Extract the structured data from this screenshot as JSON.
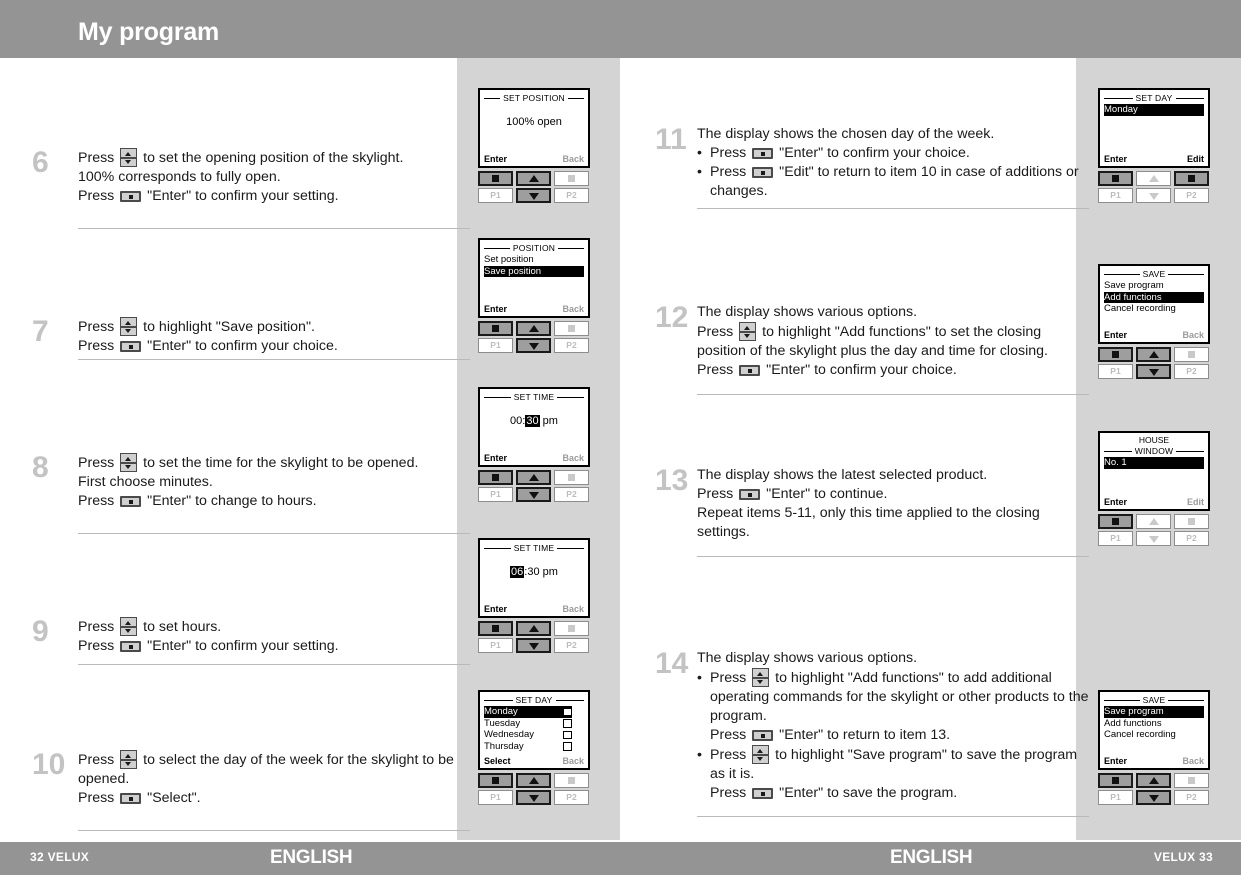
{
  "header": {
    "title": "My program"
  },
  "footer": {
    "left_page": "32  VELUX",
    "left_lang": "ENGLISH",
    "right_lang": "ENGLISH",
    "right_page": "VELUX  33"
  },
  "keys": {
    "updown_icon": "up-down-rocker-key",
    "enter_icon": "enter-key"
  },
  "steps_left": [
    {
      "number": "6",
      "lines": [
        {
          "pre": "Press ",
          "key": "updown",
          "post": " to set the opening position of the skylight."
        },
        {
          "pre": "100% corresponds to fully open.",
          "key": null,
          "post": ""
        },
        {
          "pre": "Press ",
          "key": "enter",
          "post": " \"Enter\" to confirm your setting."
        }
      ]
    },
    {
      "number": "7",
      "lines": [
        {
          "pre": "Press ",
          "key": "updown",
          "post": " to highlight \"Save position\"."
        },
        {
          "pre": "Press ",
          "key": "enter",
          "post": " \"Enter\" to confirm your choice."
        }
      ]
    },
    {
      "number": "8",
      "lines": [
        {
          "pre": "Press ",
          "key": "updown",
          "post": " to set the time for the skylight to be opened."
        },
        {
          "pre": "First choose minutes.",
          "key": null,
          "post": ""
        },
        {
          "pre": "Press ",
          "key": "enter",
          "post": " \"Enter\" to change to hours."
        }
      ]
    },
    {
      "number": "9",
      "lines": [
        {
          "pre": "Press ",
          "key": "updown",
          "post": " to set hours."
        },
        {
          "pre": "Press ",
          "key": "enter",
          "post": " \"Enter\" to confirm your setting."
        }
      ]
    },
    {
      "number": "10",
      "lines": [
        {
          "pre": "Press ",
          "key": "updown",
          "post": " to select the day of the week for the skylight to be opened."
        },
        {
          "pre": "Press ",
          "key": "enter",
          "post": " \"Select\"."
        }
      ]
    }
  ],
  "steps_right": [
    {
      "number": "11",
      "lines": [
        {
          "pre": "The display shows the chosen day of the week.",
          "key": null,
          "post": ""
        },
        {
          "bullet": true,
          "pre": "Press ",
          "key": "enter",
          "post": " \"Enter\" to confirm your choice."
        },
        {
          "bullet": true,
          "pre": "Press ",
          "key": "enter",
          "post": " \"Edit\" to return to item 10 in case of additions or changes."
        }
      ]
    },
    {
      "number": "12",
      "lines": [
        {
          "pre": "The display shows various options.",
          "key": null,
          "post": ""
        },
        {
          "pre": "Press ",
          "key": "updown",
          "post": " to highlight \"Add functions\" to set the closing position of the skylight plus the day and time for closing."
        },
        {
          "pre": "Press ",
          "key": "enter",
          "post": " \"Enter\" to confirm your choice."
        }
      ]
    },
    {
      "number": "13",
      "lines": [
        {
          "pre": "The display shows the latest selected product.",
          "key": null,
          "post": ""
        },
        {
          "pre": "Press ",
          "key": "enter",
          "post": " \"Enter\" to continue."
        },
        {
          "pre": "Repeat items 5-11, only this time applied to the closing settings.",
          "key": null,
          "post": ""
        }
      ]
    },
    {
      "number": "14",
      "lines": [
        {
          "pre": "The display shows various options.",
          "key": null,
          "post": ""
        },
        {
          "bullet": true,
          "pre": "Press ",
          "key": "updown",
          "post": " to highlight \"Add functions\" to add additional operating commands for the skylight or other products to the program."
        },
        {
          "pre": "Press ",
          "key": "enter",
          "post": " \"Enter\" to return to item 13.",
          "indent": true
        },
        {
          "bullet": true,
          "pre": "Press ",
          "key": "updown",
          "post": " to highlight \"Save program\" to save the program as it is."
        },
        {
          "pre": "Press ",
          "key": "enter",
          "post": " \"Enter\" to save the program.",
          "indent": true
        }
      ]
    }
  ],
  "units_left": [
    {
      "id": "set-position",
      "title": "SET POSITION",
      "title_style": "rules-both",
      "center": "100% open",
      "rows": [],
      "foot_left": "Enter",
      "foot_right": "Back",
      "foot_right_active": false,
      "buttons": {
        "stop": true,
        "up": true,
        "p2sq": false,
        "p1": false,
        "down": true,
        "p2": false
      }
    },
    {
      "id": "position",
      "title": "POSITION",
      "title_style": "rules-both",
      "center": null,
      "rows": [
        {
          "label": "Set position",
          "selected": false,
          "checkbox": false
        },
        {
          "label": "Save position",
          "selected": true,
          "checkbox": false
        }
      ],
      "foot_left": "Enter",
      "foot_right": "Back",
      "foot_right_active": false,
      "buttons": {
        "stop": true,
        "up": true,
        "p2sq": false,
        "p1": false,
        "down": true,
        "p2": false
      }
    },
    {
      "id": "set-time-minutes",
      "title": "SET TIME",
      "title_style": "rules-both",
      "center_parts": [
        {
          "text": "00:",
          "hl": false
        },
        {
          "text": "30",
          "hl": true
        },
        {
          "text": " pm",
          "hl": false
        }
      ],
      "rows": [],
      "foot_left": "Enter",
      "foot_right": "Back",
      "foot_right_active": false,
      "buttons": {
        "stop": true,
        "up": true,
        "p2sq": false,
        "p1": false,
        "down": true,
        "p2": false
      }
    },
    {
      "id": "set-time-hours",
      "title": "SET TIME",
      "title_style": "rules-both",
      "center_parts": [
        {
          "text": "06",
          "hl": true
        },
        {
          "text": ":30 pm",
          "hl": false
        }
      ],
      "rows": [],
      "foot_left": "Enter",
      "foot_right": "Back",
      "foot_right_active": false,
      "buttons": {
        "stop": true,
        "up": true,
        "p2sq": false,
        "p1": false,
        "down": true,
        "p2": false
      }
    },
    {
      "id": "set-day-list",
      "title": "SET DAY",
      "title_style": "rules-both",
      "center": null,
      "rows": [
        {
          "label": "Monday",
          "selected": true,
          "checkbox": true
        },
        {
          "label": "Tuesday",
          "selected": false,
          "checkbox": true
        },
        {
          "label": "Wednesday",
          "selected": false,
          "checkbox": true
        },
        {
          "label": "Thursday",
          "selected": false,
          "checkbox": true
        }
      ],
      "foot_left": "Select",
      "foot_right": "Back",
      "foot_right_active": false,
      "buttons": {
        "stop": true,
        "up": true,
        "p2sq": false,
        "p1": false,
        "down": true,
        "p2": false
      }
    }
  ],
  "units_right": [
    {
      "id": "set-day-chosen",
      "title": "SET DAY",
      "title_style": "rules-both",
      "center": null,
      "rows": [
        {
          "label": "Monday",
          "selected": true,
          "checkbox": false
        }
      ],
      "foot_left": "Enter",
      "foot_right": "Edit",
      "foot_right_active": true,
      "buttons": {
        "stop": true,
        "up": false,
        "p2sq": true,
        "p1": false,
        "down": false,
        "p2": false
      }
    },
    {
      "id": "save-add-functions",
      "title": "SAVE",
      "title_style": "rules-both",
      "center": null,
      "rows": [
        {
          "label": "Save program",
          "selected": false,
          "checkbox": false
        },
        {
          "label": "Add functions",
          "selected": true,
          "checkbox": false
        },
        {
          "label": "Cancel recording",
          "selected": false,
          "checkbox": false
        }
      ],
      "foot_left": "Enter",
      "foot_right": "Back",
      "foot_right_active": false,
      "buttons": {
        "stop": true,
        "up": true,
        "p2sq": false,
        "p1": false,
        "down": true,
        "p2": false
      }
    },
    {
      "id": "house-window",
      "title": "WINDOW",
      "title2": "HOUSE",
      "title_style": "rules-both",
      "center": null,
      "rows": [
        {
          "label": "No. 1",
          "selected": true,
          "checkbox": false
        }
      ],
      "foot_left": "Enter",
      "foot_right": "Edit",
      "foot_right_active": false,
      "buttons": {
        "stop": true,
        "up": false,
        "p2sq": false,
        "p1": false,
        "down": false,
        "p2": false
      }
    },
    {
      "id": "save-save-program",
      "title": "SAVE",
      "title_style": "rules-both",
      "center": null,
      "rows": [
        {
          "label": "Save program",
          "selected": true,
          "checkbox": false
        },
        {
          "label": "Add functions",
          "selected": false,
          "checkbox": false
        },
        {
          "label": "Cancel recording",
          "selected": false,
          "checkbox": false
        }
      ],
      "foot_left": "Enter",
      "foot_right": "Back",
      "foot_right_active": false,
      "buttons": {
        "stop": true,
        "up": true,
        "p2sq": false,
        "p1": false,
        "down": true,
        "p2": false
      }
    }
  ],
  "button_labels": {
    "p1": "P1",
    "p2": "P2"
  },
  "colors": {
    "header_grey": "#949494",
    "panel_grey": "#d4d4d4",
    "step_number": "#c3c3c3",
    "rule": "#b9b9b9"
  }
}
